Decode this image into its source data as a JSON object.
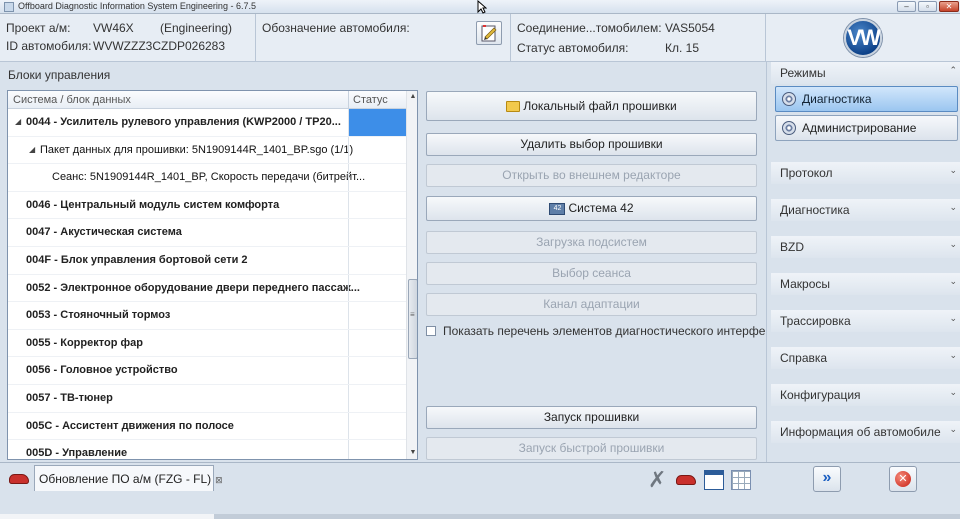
{
  "window": {
    "title": "Offboard Diagnostic Information System Engineering - 6.7.5"
  },
  "header": {
    "project_label": "Проект а/м:",
    "project_value": "VW46X",
    "project_mode": "(Engineering)",
    "vin_label": "ID автомобиля:",
    "vin_value": "WVWZZZ3CZDP026283",
    "designation_label": "Обозначение автомобиля:",
    "connection_label": "Соединение...томобилем:",
    "connection_value": "VAS5054",
    "state_label": "Статус автомобиля:",
    "state_value": "Кл. 15",
    "logo_text": "VW"
  },
  "main": {
    "section_title": "Блоки управления",
    "table": {
      "col_system": "Система / блок данных",
      "col_status": "Статус",
      "rows": [
        {
          "text": "0044 - Усилитель рулевого управления  (KWP2000 / TP20...",
          "bold": true,
          "indent": 0,
          "expander": "◢",
          "selected": true
        },
        {
          "text": "Пакет данных для прошивки: 5N1909144R_1401_BP.sgo (1/1)",
          "bold": false,
          "indent": 1,
          "expander": "◢",
          "selected": false
        },
        {
          "text": "Сеанс: 5N1909144R_1401_BP, Скорость передачи (битрейт...",
          "bold": false,
          "indent": 2,
          "expander": "",
          "selected": false
        },
        {
          "text": "0046 - Центральный модуль систем комфорта",
          "bold": true,
          "indent": 0,
          "expander": "",
          "selected": false
        },
        {
          "text": "0047 - Акустическая система",
          "bold": true,
          "indent": 0,
          "expander": "",
          "selected": false
        },
        {
          "text": "004F - Блок управления бортовой сети 2",
          "bold": true,
          "indent": 0,
          "expander": "",
          "selected": false
        },
        {
          "text": "0052 - Электронное оборудование двери переднего пассаж...",
          "bold": true,
          "indent": 0,
          "expander": "",
          "selected": false
        },
        {
          "text": "0053 - Стояночный тормоз",
          "bold": true,
          "indent": 0,
          "expander": "",
          "selected": false
        },
        {
          "text": "0055 - Корректор фар",
          "bold": true,
          "indent": 0,
          "expander": "",
          "selected": false
        },
        {
          "text": "0056 - Головное устройство",
          "bold": true,
          "indent": 0,
          "expander": "",
          "selected": false
        },
        {
          "text": "0057 - ТВ-тюнер",
          "bold": true,
          "indent": 0,
          "expander": "",
          "selected": false
        },
        {
          "text": "005C - Ассистент движения по полосе",
          "bold": true,
          "indent": 0,
          "expander": "",
          "selected": false
        },
        {
          "text": "005D - Управление",
          "bold": true,
          "indent": 0,
          "expander": "",
          "selected": false
        }
      ]
    },
    "buttons": {
      "local_file": "Локальный файл прошивки",
      "delete_selection": "Удалить выбор прошивки",
      "open_external": "Открыть во внешнем редакторе",
      "system42": "Система 42",
      "load_subsystems": "Загрузка подсистем",
      "select_session": "Выбор сеанса",
      "adaptation_channel": "Канал адаптации",
      "start_flash": "Запуск прошивки",
      "start_quick_flash": "Запуск быстрой прошивки"
    },
    "show_diag_list_label": "Показать перечень элементов диагностического интерфейса"
  },
  "sidebar": {
    "modes_label": "Режимы",
    "mode_diagnostics": "Диагностика",
    "mode_admin": "Администрирование",
    "sections": [
      "Протокол",
      "Диагностика",
      "BZD",
      "Макросы",
      "Трассировка",
      "Справка",
      "Конфигурация",
      "Информация об автомобиле"
    ]
  },
  "bottom": {
    "tab_label": "Обновление ПО а/м (FZG - FL)",
    "tab_close": "⊠"
  },
  "colors": {
    "selection": "#3d8ee8",
    "active_mode": "#9bc6f0",
    "panel_bg": "#d9e2ec"
  }
}
